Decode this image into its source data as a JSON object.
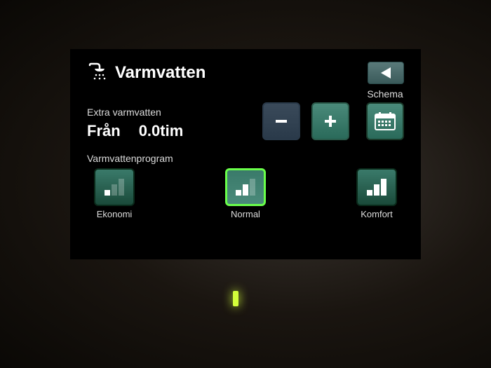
{
  "header": {
    "title": "Varmvatten"
  },
  "extra": {
    "label": "Extra varmvatten",
    "state": "Från",
    "duration": "0.0tim"
  },
  "schedule": {
    "label": "Schema"
  },
  "program": {
    "label": "Varmvattenprogram",
    "items": [
      {
        "name": "Ekonomi",
        "bars": 1,
        "selected": false
      },
      {
        "name": "Normal",
        "bars": 2,
        "selected": true
      },
      {
        "name": "Komfort",
        "bars": 3,
        "selected": false
      }
    ]
  }
}
